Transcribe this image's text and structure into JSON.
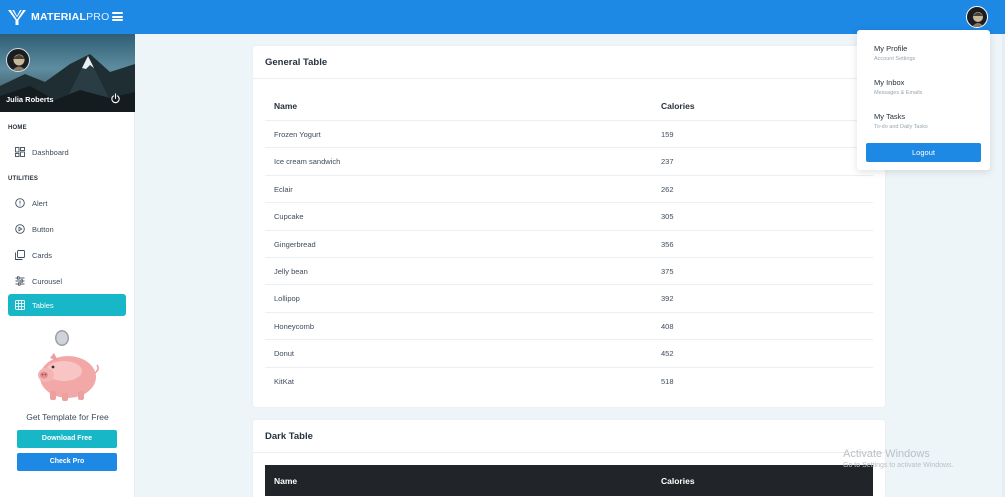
{
  "app": {
    "brand_bold": "MATERIAL",
    "brand_light": "PRO"
  },
  "sidebar": {
    "profile_name": "Julia Roberts",
    "sections": [
      {
        "label": "HOME"
      },
      {
        "label": "UTILITIES"
      }
    ],
    "items": [
      {
        "label": "Dashboard",
        "icon": "dashboard-icon"
      },
      {
        "label": "Alert",
        "icon": "alert-circle-icon"
      },
      {
        "label": "Button",
        "icon": "play-circle-icon"
      },
      {
        "label": "Cards",
        "icon": "cards-icon"
      },
      {
        "label": "Curousel",
        "icon": "sliders-icon"
      },
      {
        "label": "Tables",
        "icon": "table-icon",
        "active": true
      }
    ],
    "promo": {
      "text": "Get Template for Free",
      "download_label": "Download Free",
      "pro_label": "Check Pro"
    }
  },
  "general_table": {
    "title": "General Table",
    "columns": [
      "Name",
      "Calories"
    ],
    "rows": [
      {
        "name": "Frozen Yogurt",
        "calories": "159"
      },
      {
        "name": "Ice cream sandwich",
        "calories": "237"
      },
      {
        "name": "Eclair",
        "calories": "262"
      },
      {
        "name": "Cupcake",
        "calories": "305"
      },
      {
        "name": "Gingerbread",
        "calories": "356"
      },
      {
        "name": "Jelly bean",
        "calories": "375"
      },
      {
        "name": "Lollipop",
        "calories": "392"
      },
      {
        "name": "Honeycomb",
        "calories": "408"
      },
      {
        "name": "Donut",
        "calories": "452"
      },
      {
        "name": "KitKat",
        "calories": "518"
      }
    ]
  },
  "dark_table": {
    "title": "Dark Table",
    "columns": [
      "Name",
      "Calories"
    ]
  },
  "user_menu": {
    "items": [
      {
        "title": "My Profile",
        "subtitle": "Account Settings"
      },
      {
        "title": "My Inbox",
        "subtitle": "Messages & Emails"
      },
      {
        "title": "My Tasks",
        "subtitle": "To-do and Daily Tasks"
      }
    ],
    "logout_label": "Logout"
  },
  "watermark": {
    "title": "Activate Windows",
    "subtitle": "Go to Settings to activate Windows."
  },
  "colors": {
    "primary": "#1e88e5",
    "accent": "#18b7c7",
    "background": "#eef5f9",
    "dark_header": "#212529"
  }
}
